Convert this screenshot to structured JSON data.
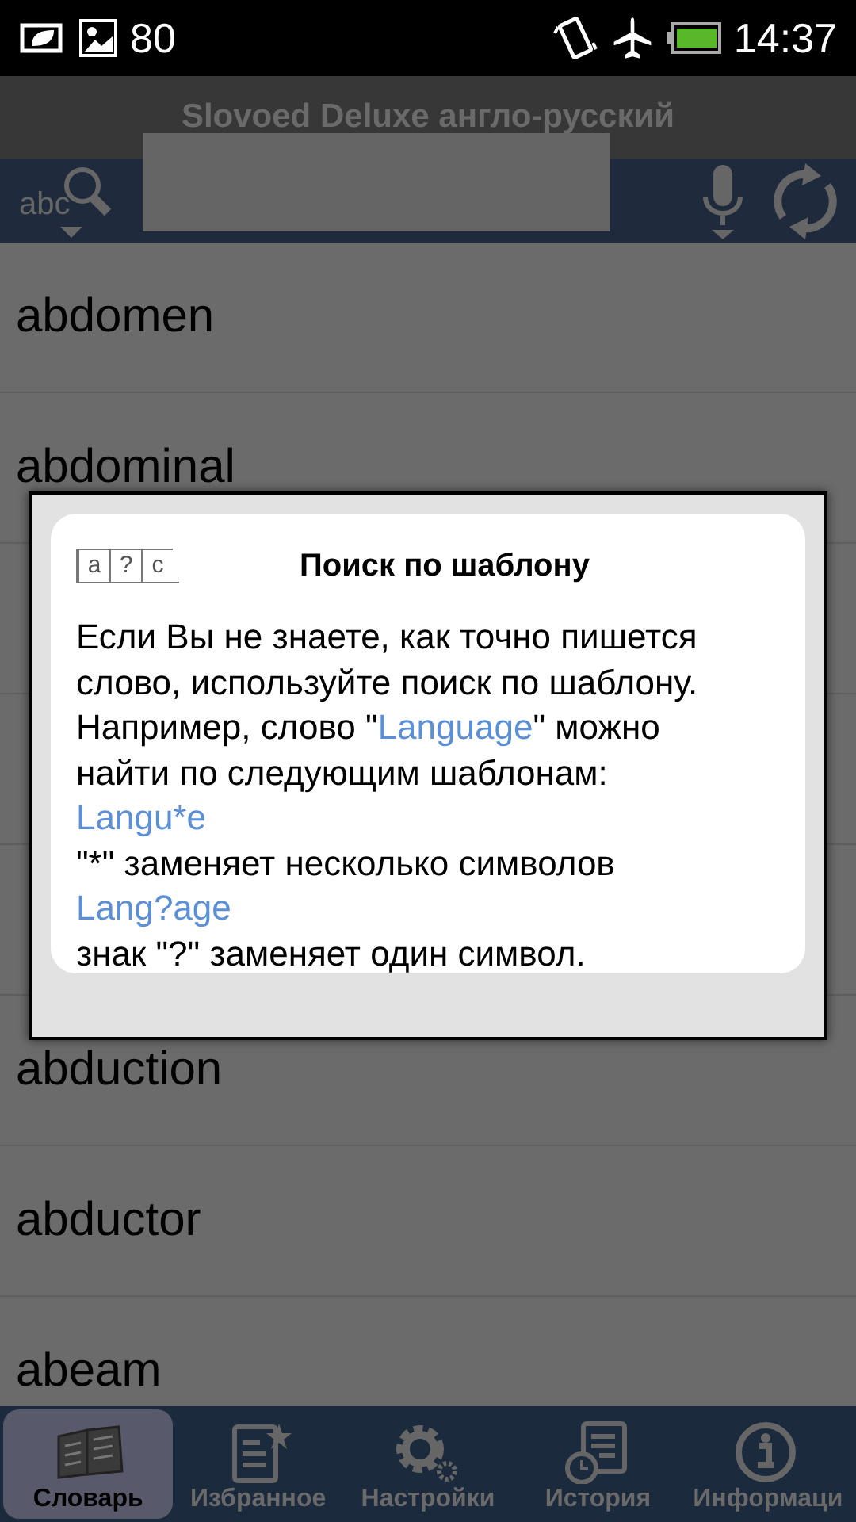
{
  "status_bar": {
    "notification_count": "80",
    "time": "14:37"
  },
  "title": "Slovoed Deluxe англо-русский",
  "search": {
    "mode_label": "abc"
  },
  "words": [
    "abdomen",
    "abdominal",
    "abduction",
    "abductor",
    "abeam"
  ],
  "dialog": {
    "icon_letters": [
      "a",
      "?",
      "c"
    ],
    "title": "Поиск по шаблону",
    "blocks": [
      {
        "kind": "paragraph",
        "segments": [
          {
            "text": "Если Вы не знаете, как точно пишется слово, используйте поиск по шаблону. Например, слово \"",
            "highlight": false
          },
          {
            "text": "Language",
            "highlight": true
          },
          {
            "text": "\" можно найти по следующим шаблонам:",
            "highlight": false
          }
        ]
      },
      {
        "kind": "pattern",
        "text": "Langu*e"
      },
      {
        "kind": "line",
        "text": "\"*\" заменяет несколько символов"
      },
      {
        "kind": "pattern",
        "text": "Lang?age"
      },
      {
        "kind": "line",
        "text": "знак \"?\" заменяет один символ."
      }
    ]
  },
  "tabs": [
    {
      "label": "Словарь",
      "selected": true
    },
    {
      "label": "Избранное",
      "selected": false
    },
    {
      "label": "Настройки",
      "selected": false
    },
    {
      "label": "История",
      "selected": false
    },
    {
      "label": "Информаци",
      "selected": false
    }
  ]
}
